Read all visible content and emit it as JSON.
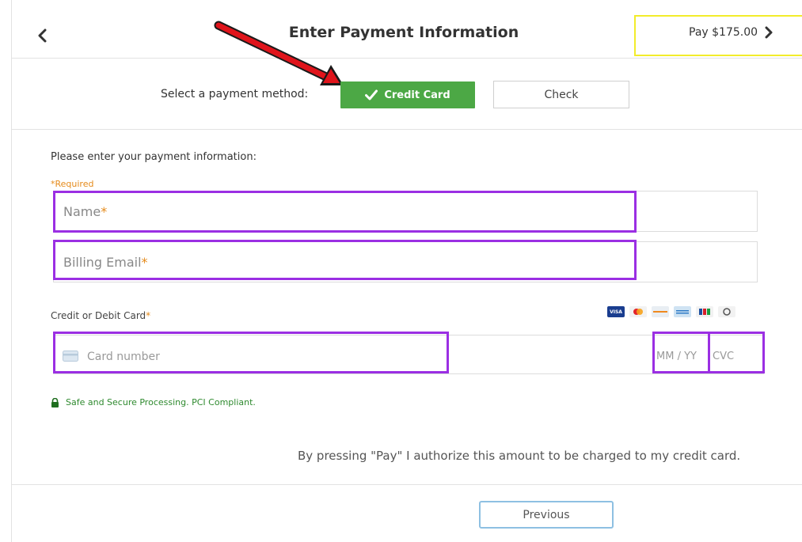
{
  "header": {
    "title": "Enter Payment Information",
    "pay_label": "Pay $175.00"
  },
  "payment_method": {
    "label": "Select a payment method:",
    "options": [
      {
        "label": "Credit Card",
        "selected": true
      },
      {
        "label": "Check",
        "selected": false
      }
    ]
  },
  "form": {
    "heading": "Please enter your payment information:",
    "required_note": "*Required",
    "name_placeholder": "Name",
    "email_placeholder": "Billing Email",
    "required_star": "*",
    "card_section_label": "Credit or Debit Card",
    "card_number_placeholder": "Card number",
    "expiry_placeholder": "MM / YY",
    "cvc_placeholder": "CVC",
    "card_brand_icons": [
      "visa-icon",
      "mastercard-icon",
      "discover-icon",
      "amex-icon",
      "jcb-icon",
      "diners-icon"
    ]
  },
  "secure_note": "Safe and Secure Processing. PCI Compliant.",
  "authorization_text": "By pressing \"Pay\" I authorize this amount to be charged to my credit card.",
  "footer": {
    "previous_label": "Previous"
  },
  "colors": {
    "accent_green": "#4ca845",
    "required_orange": "#e58a1a",
    "annotation_purple": "#9b2fe3",
    "annotation_yellow": "#f2ec2b",
    "annotation_arrow": "#e0141b",
    "secure_green": "#2f8a2f"
  }
}
